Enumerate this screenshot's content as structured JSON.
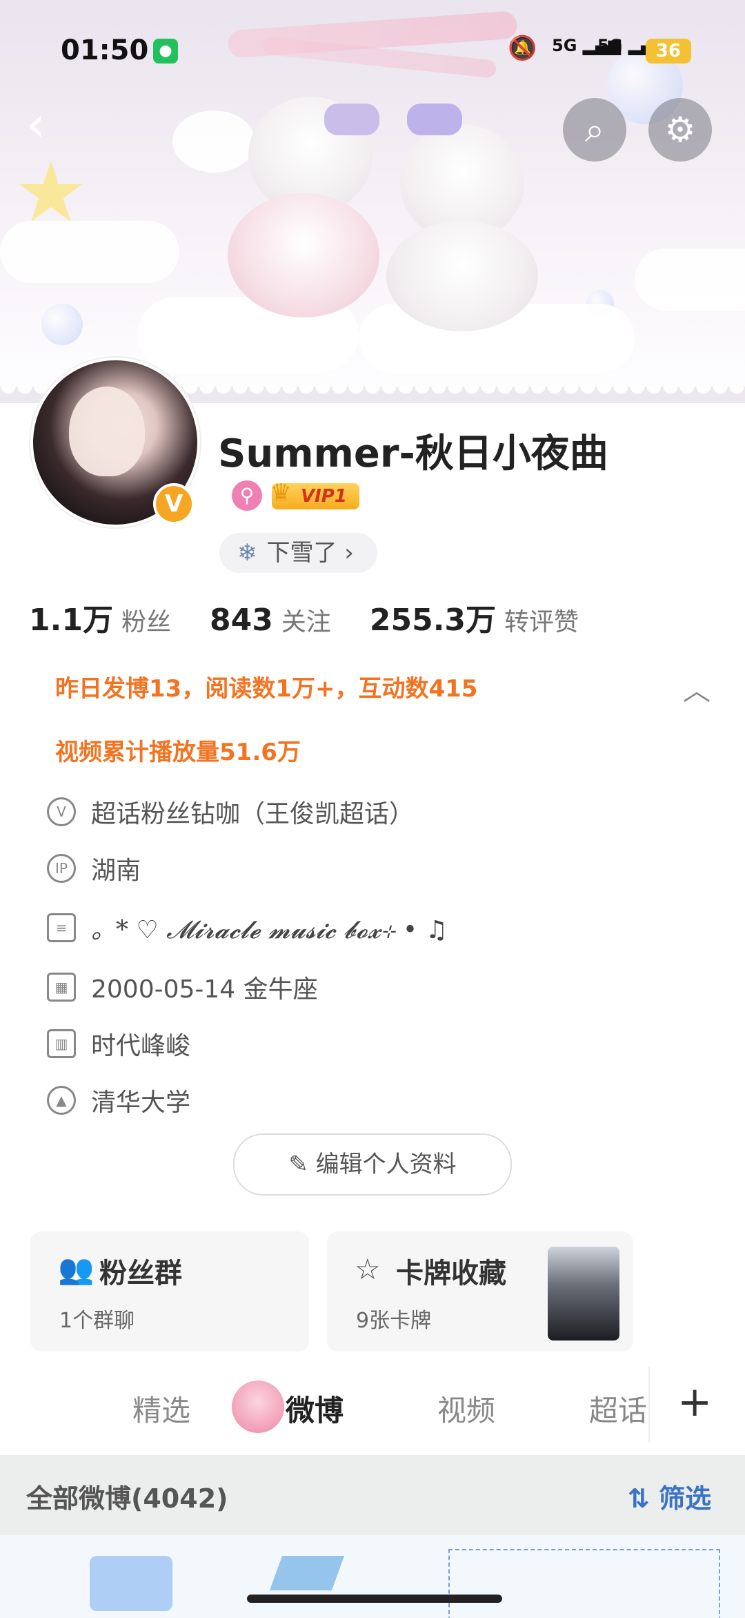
{
  "status_bar": {
    "time": "01:50",
    "net1": "5G",
    "net2": "5G",
    "battery": "36"
  },
  "profile": {
    "username": "Summer-秋日小夜曲",
    "vip_badge": "VIP1",
    "verify_badge": "V",
    "status_pill": "下雪了",
    "stats": [
      {
        "value": "1.1万",
        "label": "粉丝"
      },
      {
        "value": "843",
        "label": "关注"
      },
      {
        "value": "255.3万",
        "label": "转评赞"
      }
    ],
    "summary_line1": "昨日发博13，阅读数1万+，互动数415",
    "summary_line2": "视频累计播放量51.6万",
    "info": {
      "supertopic": "超话粉丝钻咖（王俊凯超话）",
      "ip_location": "湖南",
      "signature": "。* ♡ 𝓜𝓲𝓻𝓪𝓬𝓵𝓮 𝓶𝓾𝓼𝓲𝓬 𝓫𝓸𝔁⊹ • ♫",
      "birthday": "2000-05-14 金牛座",
      "company": "时代峰峻",
      "school": "清华大学"
    },
    "edit_button": "编辑个人资料"
  },
  "cards": {
    "fan_group": {
      "title": "粉丝群",
      "sub": "1个群聊"
    },
    "card_collection": {
      "title": "卡牌收藏",
      "sub": "9张卡牌"
    }
  },
  "tabs": [
    {
      "label": "精选"
    },
    {
      "label": "微博"
    },
    {
      "label": "视频"
    },
    {
      "label": "超话"
    }
  ],
  "feed": {
    "all_posts": "全部微博(4042)",
    "filter": "筛选"
  },
  "icons": {
    "back": "chevron-left-icon",
    "search": "search-icon",
    "settings": "gear-icon"
  },
  "colors": {
    "accent_orange": "#f37321",
    "filter_blue": "#3b72c4",
    "verify_gold": "#f5a623"
  }
}
